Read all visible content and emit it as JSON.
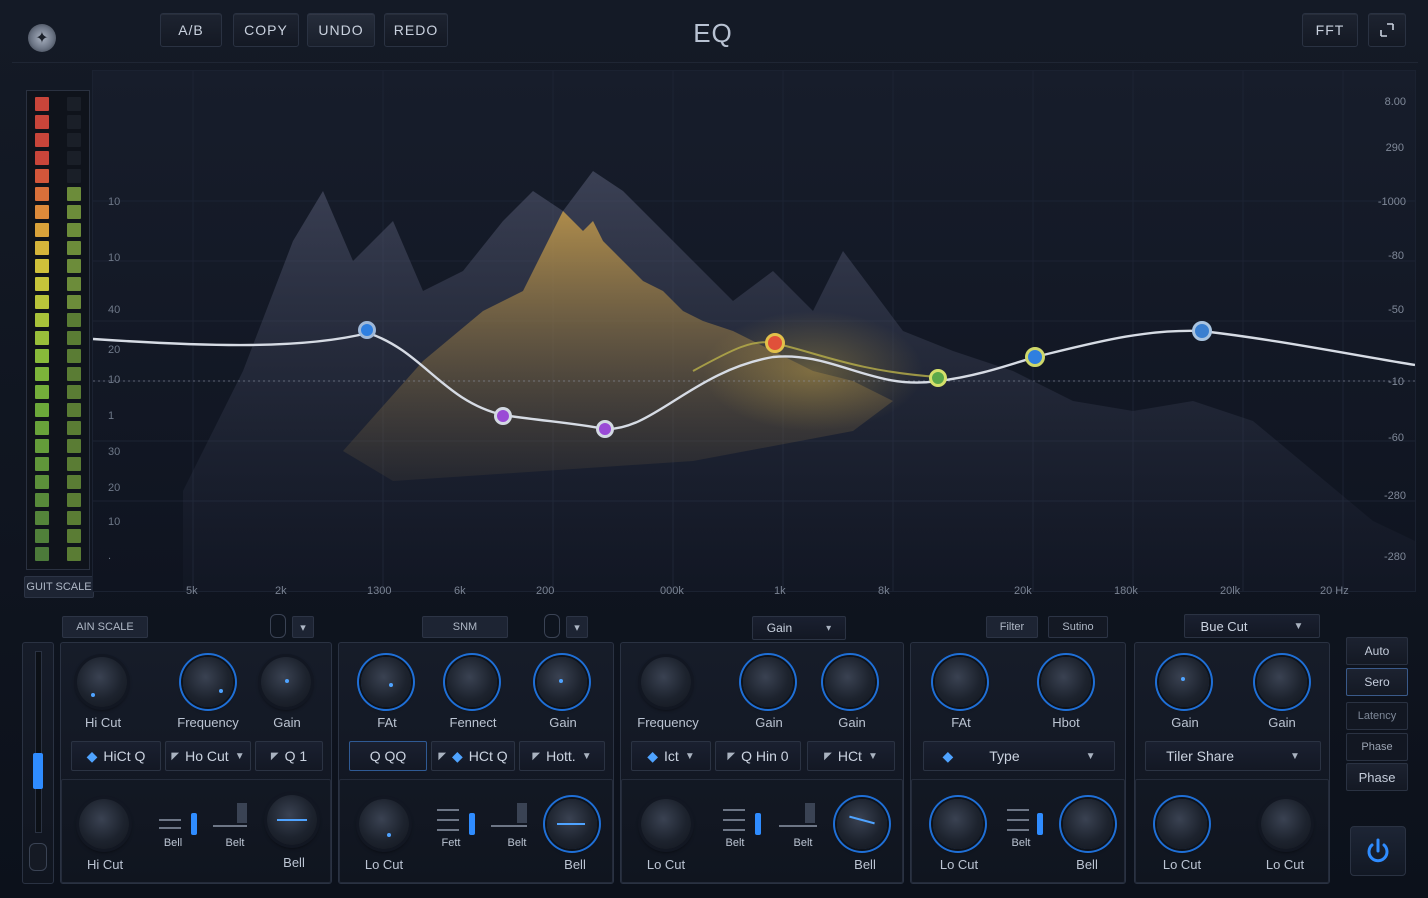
{
  "toolbar": {
    "ab": "A/B",
    "copy": "COPY",
    "undo": "UNDO",
    "redo": "REDO",
    "title": "EQ",
    "fft": "FFT",
    "resize_icon": "resize-icon"
  },
  "graph": {
    "left_axis": [
      "10",
      "10",
      "40",
      "20",
      "10",
      "1",
      "30",
      "20",
      "10",
      "."
    ],
    "right_axis": [
      "8.00",
      "290",
      "-1000",
      "-80",
      "-50",
      "-10",
      "-60",
      "-280",
      "-280"
    ],
    "freq_axis": [
      "5k",
      "2k",
      "1300",
      "6k",
      "200",
      "000k",
      "1k",
      "8k",
      "20k",
      "180k",
      "20lk",
      "20 Hz"
    ],
    "colors": {
      "accent": "#2f8cff",
      "curve": "#d6dbe4",
      "spectrum": "#b08a3e"
    }
  },
  "meter": {
    "scale_button": "GUIT SCALE"
  },
  "bands": {
    "b1": {
      "header": "AIN SCALE",
      "knobs": [
        "Hi Cut",
        "Frequency",
        "Gain"
      ],
      "selects": [
        "HiCt Q",
        "Ho Cut",
        "Q 1"
      ],
      "bottom": [
        "Hi Cut",
        "Bell",
        "Belt",
        "Bell"
      ]
    },
    "b2": {
      "header": "SNM",
      "knobs": [
        "FAt",
        "Fennect",
        "Gain"
      ],
      "selects": [
        "Q QQ",
        "HCt Q",
        "Hott."
      ],
      "bottom": [
        "Lo Cut",
        "Fett",
        "Belt",
        "Bell"
      ]
    },
    "b3": {
      "header": "Gain",
      "knobs": [
        "Frequency",
        "Gain",
        "Gain"
      ],
      "selects": [
        "Ict",
        "Q Hin 0",
        "HCt"
      ],
      "bottom": [
        "Lo Cut",
        "Belt",
        "Belt",
        "Bell"
      ]
    },
    "b4": {
      "header_a": "Filter",
      "header_b": "Sutino",
      "knobs": [
        "FAt",
        "Hbot"
      ],
      "selects": [
        "Type"
      ],
      "bottom": [
        "Lo Cut",
        "Belt",
        "Bell"
      ]
    },
    "b5": {
      "header": "Bue Cut",
      "knobs": [
        "Gain",
        "Gain"
      ],
      "selects": [
        "Tiler Share"
      ],
      "bottom": [
        "Lo Cut",
        "Lo Cut"
      ]
    }
  },
  "side": {
    "auto": "Auto",
    "sero": "Sero",
    "latency": "Latency",
    "phase1": "Phase",
    "phase2": "Phase"
  }
}
